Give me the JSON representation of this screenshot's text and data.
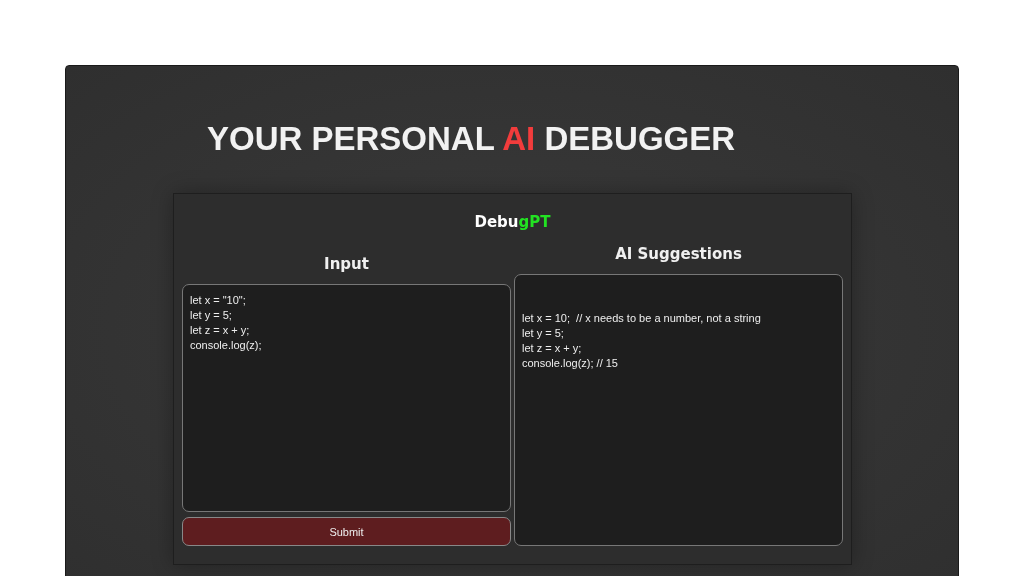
{
  "hero_title": {
    "before": "YOUR PERSONAL ",
    "highlight": "AI",
    "after": " DEBUGGER"
  },
  "app": {
    "name_start": "Debu",
    "name_accent": "gPT"
  },
  "input_panel": {
    "heading": "Input",
    "code": "let x = \"10\";\nlet y = 5;\nlet z = x + y;\nconsole.log(z);",
    "submit_label": "Submit"
  },
  "suggestions_panel": {
    "heading": "AI Suggestions",
    "code": "let x = 10;  // x needs to be a number, not a string\nlet y = 5;\nlet z = x + y;\nconsole.log(z); // 15"
  }
}
